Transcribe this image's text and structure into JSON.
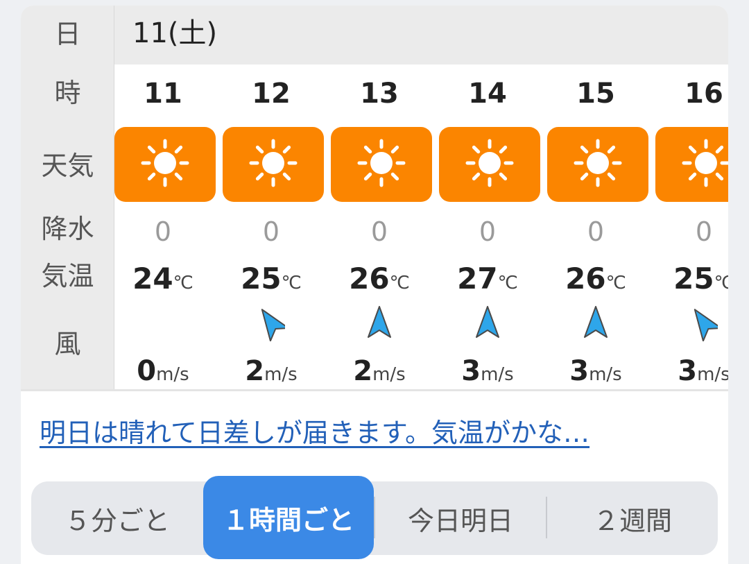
{
  "row_labels": {
    "date": "日",
    "hour": "時",
    "weather": "天気",
    "precip": "降水",
    "temp": "気温",
    "wind": "風"
  },
  "date_header": "11(土)",
  "hours": [
    {
      "hour": "11",
      "weather_icon": "sun-icon",
      "precip": "0",
      "temp": "24",
      "wind_dir": "calm",
      "wind_speed": "0"
    },
    {
      "hour": "12",
      "weather_icon": "sun-icon",
      "precip": "0",
      "temp": "25",
      "wind_dir": "north-northwest",
      "wind_speed": "2"
    },
    {
      "hour": "13",
      "weather_icon": "sun-icon",
      "precip": "0",
      "temp": "26",
      "wind_dir": "south",
      "wind_speed": "2"
    },
    {
      "hour": "14",
      "weather_icon": "sun-icon",
      "precip": "0",
      "temp": "27",
      "wind_dir": "south",
      "wind_speed": "3"
    },
    {
      "hour": "15",
      "weather_icon": "sun-icon",
      "precip": "0",
      "temp": "26",
      "wind_dir": "south",
      "wind_speed": "3"
    },
    {
      "hour": "16",
      "weather_icon": "sun-icon",
      "precip": "0",
      "temp": "25",
      "wind_dir": "north-northwest",
      "wind_speed": "3"
    }
  ],
  "units": {
    "temp": "℃",
    "wind": "m/s"
  },
  "summary_link": "明日は晴れて日差しが届きます。気温がかな…",
  "tabs": [
    {
      "label": "５分ごと",
      "active": false
    },
    {
      "label": "１時間ごと",
      "active": true
    },
    {
      "label": "今日明日",
      "active": false
    },
    {
      "label": "２週間",
      "active": false
    }
  ],
  "colors": {
    "weather_sunny": "#fb8500",
    "accent": "#3b89e6",
    "link": "#2260b8",
    "wind_arrow": "#2ea6ea"
  }
}
